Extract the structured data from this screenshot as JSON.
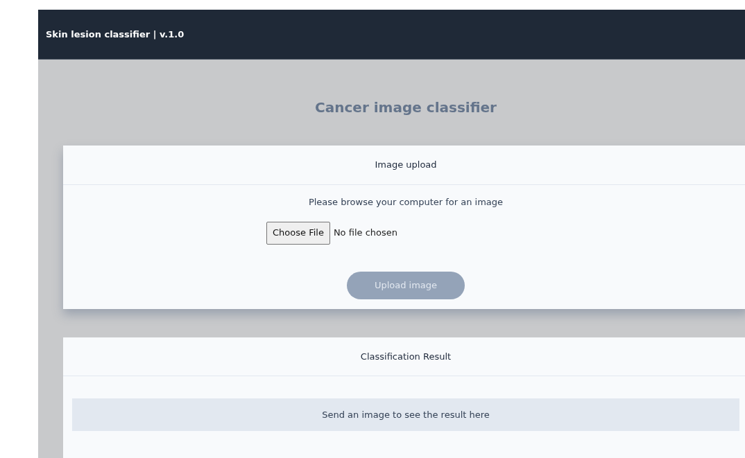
{
  "navbar": {
    "brand": "Skin lesion classifier | v.1.0"
  },
  "title": "Cancer image classifier",
  "upload_card": {
    "header": "Image upload",
    "instruction": "Please browse your computer for an image",
    "file_button": "Choose File",
    "file_status": "No file chosen",
    "upload_button": {
      "label": "Upload image",
      "disabled": true
    }
  },
  "result_card": {
    "header": "Classification Result",
    "message": "Send an image to see the result here"
  }
}
